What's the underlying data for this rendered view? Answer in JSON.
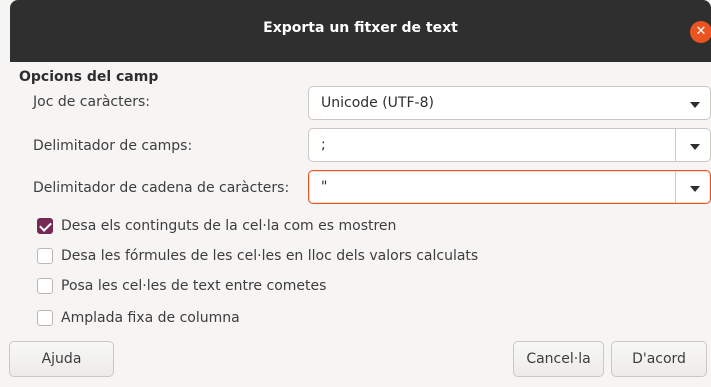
{
  "window": {
    "title": "Exporta un fitxer de text",
    "close_icon": "close-icon"
  },
  "section": {
    "title": "Opcions del camp"
  },
  "fields": [
    {
      "label": "Joc de caràcters:",
      "value": "Unicode (UTF-8)"
    },
    {
      "label": "Delimitador de camps:",
      "value": ";"
    },
    {
      "label": "Delimitador de cadena de caràcters:",
      "value": "\""
    }
  ],
  "options": [
    {
      "label": "Desa els continguts de la cel·la com es mostren",
      "checked": true
    },
    {
      "label": "Desa les fórmules de les cel·les en lloc dels valors calculats",
      "checked": false
    },
    {
      "label": "Posa les cel·les de text entre cometes",
      "checked": false
    },
    {
      "label": "Amplada fixa de columna",
      "checked": false
    }
  ],
  "buttons": {
    "help": "Ajuda",
    "cancel": "Cancel·la",
    "ok": "D'acord"
  },
  "colors": {
    "titlebar": "#2f2f2f",
    "close": "#e95420",
    "check": "#772953"
  }
}
